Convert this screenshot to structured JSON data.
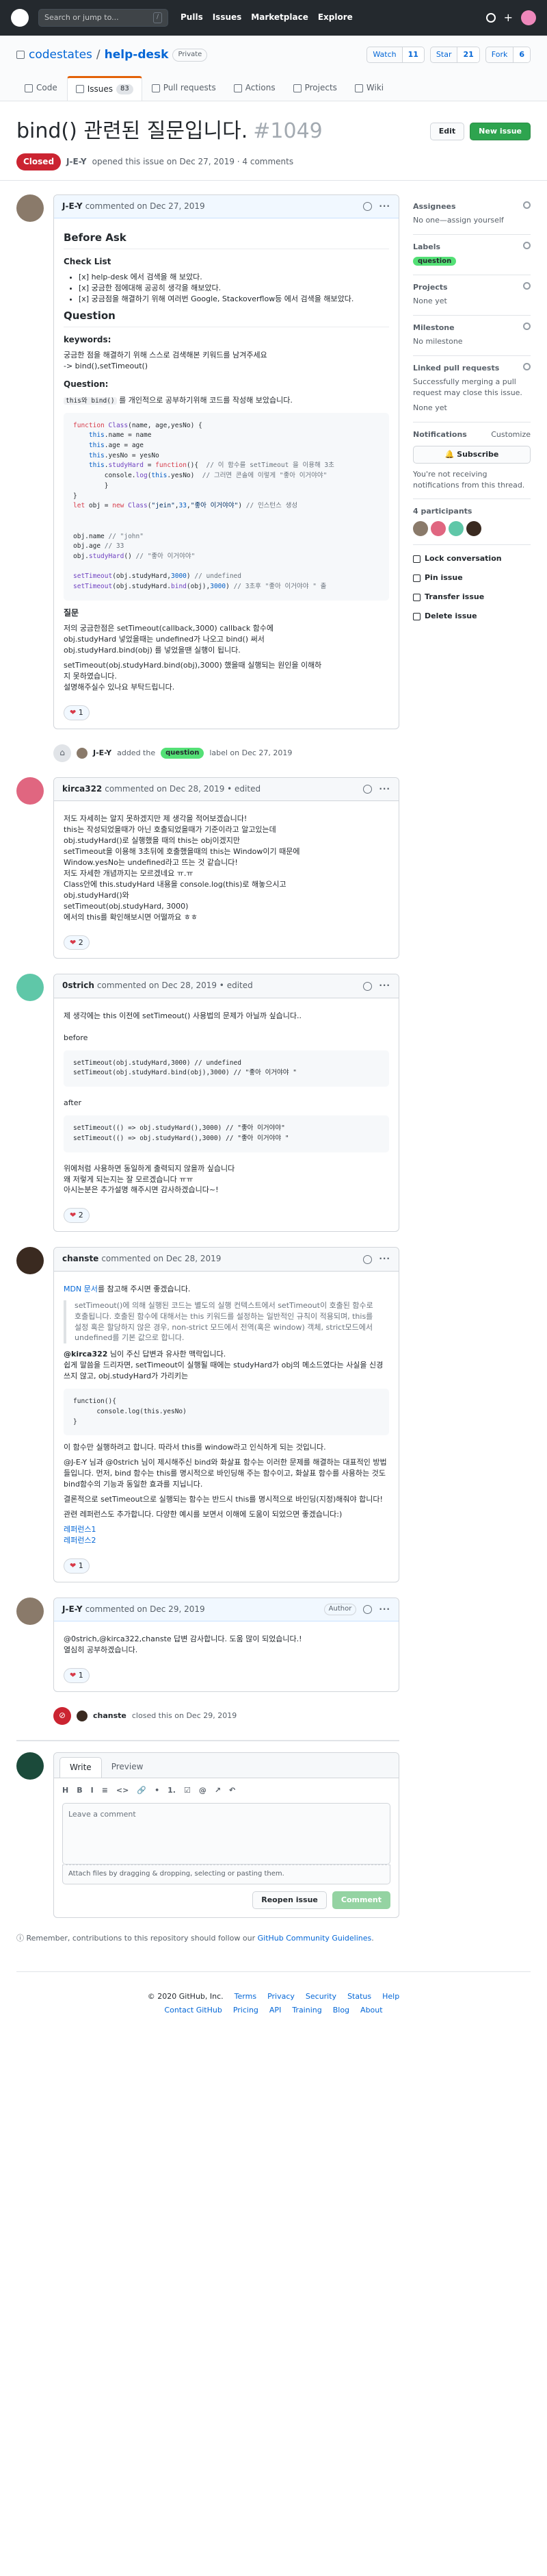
{
  "header": {
    "search_placeholder": "Search or jump to...",
    "search_key": "/",
    "nav": [
      "Pulls",
      "Issues",
      "Marketplace",
      "Explore"
    ]
  },
  "repo": {
    "owner": "codestates",
    "sep": "/",
    "name": "help-desk",
    "visibility": "Private",
    "watch": {
      "label": "Watch",
      "count": "11"
    },
    "star": {
      "label": "Star",
      "count": "21"
    },
    "fork": {
      "label": "Fork",
      "count": "6"
    },
    "tabs": [
      {
        "label": "Code"
      },
      {
        "label": "Issues",
        "count": "83"
      },
      {
        "label": "Pull requests"
      },
      {
        "label": "Actions"
      },
      {
        "label": "Projects"
      },
      {
        "label": "Wiki"
      }
    ]
  },
  "issue": {
    "title": "bind() 관련된 질문입니다.",
    "number": "#1049",
    "edit": "Edit",
    "new_issue": "New issue",
    "state": "Closed",
    "author": "J-E-Y",
    "opened_text": "opened this issue on Dec 27, 2019 · 4 comments"
  },
  "c1": {
    "author": "J-E-Y",
    "when": "commented on Dec 27, 2019",
    "h_before": "Before Ask",
    "h_check": "Check List",
    "checks": [
      "[x] help-desk 에서 검색을 해 보았다.",
      "[x] 궁금한 점에대해 공공히 생각을 해보았다.",
      "[x] 궁금점을 해결하기 위해 여러번 Google, Stackoverflow등 에서 검색을 해보았다."
    ],
    "h_question": "Question",
    "h_keywords": "keywords:",
    "kw1": "궁금한 점을 해결하기 위해 스스로 검색해본 키워드를 남겨주세요",
    "kw2": "-> bind(),setTimeout()",
    "q_label": "Question:",
    "q_code": "this와 bind()",
    "q_text": "를 개인적으로 공부하기위해 코드를 작성해 보았습니다.",
    "code1": [
      "function Class(name, age,yesNo) {",
      "    this.name = name",
      "    this.age = age",
      "    this.yesNo = yesNo",
      "    this.studyHard = function(){  // 이 함수를 setTimeout 을 이용해 3초",
      "        console.log(this.yesNo)  // 그러면 콘솔에 이렇게 \"좋아 이거야야\"",
      "        }",
      "}",
      "let obj = new Class(\"jein\",33,\"좋아 이거야야\") // 인스턴스 생성",
      "",
      "",
      "obj.name // \"john\"",
      "obj.age // 33",
      "obj.studyHard() // \"좋아 이거야야\"",
      "",
      "setTimeout(obj.studyHard,3000) // undefined",
      "setTimeout(obj.studyHard.bind(obj),3000) // 3초후 \"좋아 이거야야 \" 출"
    ],
    "h_ask": "질문",
    "ask_lines": [
      "저의 궁금한점은  setTimeout(callback,3000)  callback 함수에",
      "obj.studyHard  넣었을때는 undefined가 나오고 bind() 써서",
      "obj.studyHard.bind(obj)  를 넣었을땐 실행이 됩니다.",
      "",
      "setTimeout(obj.studyHard.bind(obj),3000)  했을때 실행되는 원인을 이해하",
      "지 못하였습니다.",
      "설명해주실수 있나요 부탁드립니다."
    ],
    "reaction": "1"
  },
  "ev1": {
    "actor": "J-E-Y",
    "pre": "added the",
    "label": "question",
    "post": "label on Dec 27, 2019"
  },
  "c2": {
    "author": "kirca322",
    "when": "commented on Dec 28, 2019 • edited",
    "lines": [
      "저도 자세히는 알지 못하겠지만 제 생각을 적어보겠습니다!",
      "this는 작성되었을때가 아닌 호출되었을때가 기준이라고 알고있는데",
      "obj.studyHard()로 실행했을 때의 this는 obj이겠지만",
      "setTimeout을 이용해 3초뒤에 호출했을때의 this는 Window이기 때문에",
      "Window.yesNo는 undefined라고 뜨는 것 같습니다!",
      "저도 자세한 개념까지는 모르겠네요 ㅠ.ㅠ",
      "Class안에 this.studyHard 내용을 console.log(this)로 해놓으시고",
      "obj.studyHard()와",
      "setTimeout(obj.studyHard, 3000)",
      "에서의 this를 확인해보시면 어떨까요 ㅎㅎ"
    ],
    "reaction": "2"
  },
  "c3": {
    "author": "0strich",
    "when": "commented on Dec 28, 2019 • edited",
    "intro": "제 생각에는 this 이전에 setTimeout() 사용법의 문제가 아닐까 싶습니다..",
    "before": "before",
    "code_before": [
      "setTimeout(obj.studyHard,3000) // undefined",
      "setTimeout(obj.studyHard.bind(obj),3000) // \"좋아 이거야야 \""
    ],
    "after": "after",
    "code_after": [
      "setTimeout(() => obj.studyHard(),3000) // \"좋아 이거야야\"",
      "setTimeout(() => obj.studyHard(),3000) // \"좋아 이거야야 \""
    ],
    "outro": [
      "위에처럼 사용하면 동일하게 출력되지 않을까 싶습니다",
      "왜 저렇게 되는지는 잘 모르겠습니다 ㅠㅠ",
      "아시는분은 추가설명 해주시면 감사하겠습니다~!"
    ],
    "reaction": "2"
  },
  "c4": {
    "author": "chanste",
    "when": "commented on Dec 28, 2019",
    "mdn": "MDN 문서",
    "mdn_rest": "를 참고해 주시면 좋겠습니다.",
    "quote": "setTimeout()에 의해 실행된 코드는 별도의 실행 컨텍스트에서 setTimeout이 호출된 함수로 호출됩니다. 호출된 함수에 대해서는 this 키워드를 설정하는 일반적인 규칙이 적용되며, this를 설정 혹은 할당하지 않은 경우, non-strict 모드에서 전역(혹은 window) 객체, strict모드에서 undefined를 기본 값으로 합니다.",
    "p1_mention": "@kirca322",
    "p1": "님이 주신 답변과 유사한 맥락입니다.",
    "p1b": "쉽게 말씀을 드리자면, setTimeout이 실행될 때에는 studyHard가 obj의 메소드였다는 사실을 신경쓰지 않고, obj.studyHard가 가리키는",
    "code": [
      "function(){",
      "      console.log(this.yesNo)",
      "}"
    ],
    "p2": "이 함수만 실행하려고 합니다. 따라서 this를 window라고 인식하게 되는 것입니다.",
    "p3": "@J-E-Y 님과 @0strich 님이 제시해주신 bind와 화살표 함수는 이러한 문제를 해결하는 대표적인 방법들입니다. 먼저, bind 함수는 this를 명시적으로 바인딩해 주는 함수이고, 화살표 함수를 사용하는 것도 bind함수의 기능과 동일한 효과를 지닙니다.",
    "p4": "결론적으로 setTimeout으로 실행되는 함수는 반드시 this를 명시적으로 바인딩(지정)해줘야 합니다!",
    "p5": "관련 레퍼런스도 추가합니다. 다양한 예시를 보면서 이해에 도움이 되었으면 좋겠습니다:)",
    "links": [
      "레퍼런스1",
      "레퍼런스2"
    ],
    "reaction": "1"
  },
  "c5": {
    "author": "J-E-Y",
    "when": "commented on Dec 29, 2019",
    "badge": "Author",
    "lines": [
      "@0strich,@kirca322,chanste 답변 감사합니다. 도움 많이 되었습니다.!",
      "열심히 공부하겠습니다."
    ],
    "reaction": "1"
  },
  "ev2": {
    "actor": "chanste",
    "text": "closed this on Dec 29, 2019"
  },
  "editor": {
    "tab_write": "Write",
    "tab_preview": "Preview",
    "tools": [
      "H",
      "B",
      "I",
      "≡",
      "<>",
      "🔗",
      "•",
      "1.",
      "☑",
      "@",
      "↗",
      "↶"
    ],
    "placeholder": "Leave a comment",
    "attach": "Attach files by dragging & dropping, selecting or pasting them.",
    "reopen": "Reopen issue",
    "comment": "Comment"
  },
  "tip": {
    "text": "Remember, contributions to this repository should follow our",
    "link": "GitHub Community Guidelines",
    "end": "."
  },
  "sidebar": {
    "assignees": {
      "title": "Assignees",
      "value": "No one—assign yourself"
    },
    "labels": {
      "title": "Labels",
      "value": "question"
    },
    "projects": {
      "title": "Projects",
      "value": "None yet"
    },
    "milestone": {
      "title": "Milestone",
      "value": "No milestone"
    },
    "linked": {
      "title": "Linked pull requests",
      "desc": "Successfully merging a pull request may close this issue.",
      "value": "None yet"
    },
    "notifications": {
      "title": "Notifications",
      "customize": "Customize",
      "button": "Subscribe",
      "desc": "You're not receiving notifications from this thread."
    },
    "participants": {
      "title": "4 participants"
    },
    "actions": [
      "Lock conversation",
      "Pin issue",
      "Transfer issue",
      "Delete issue"
    ]
  },
  "footer": {
    "copy": "© 2020 GitHub, Inc.",
    "row1": [
      "Terms",
      "Privacy",
      "Security",
      "Status",
      "Help"
    ],
    "row2": [
      "Contact GitHub",
      "Pricing",
      "API",
      "Training",
      "Blog",
      "About"
    ]
  },
  "colors": {
    "closed": "#cb2431",
    "accent": "#0366d6",
    "label": "#54e076"
  }
}
